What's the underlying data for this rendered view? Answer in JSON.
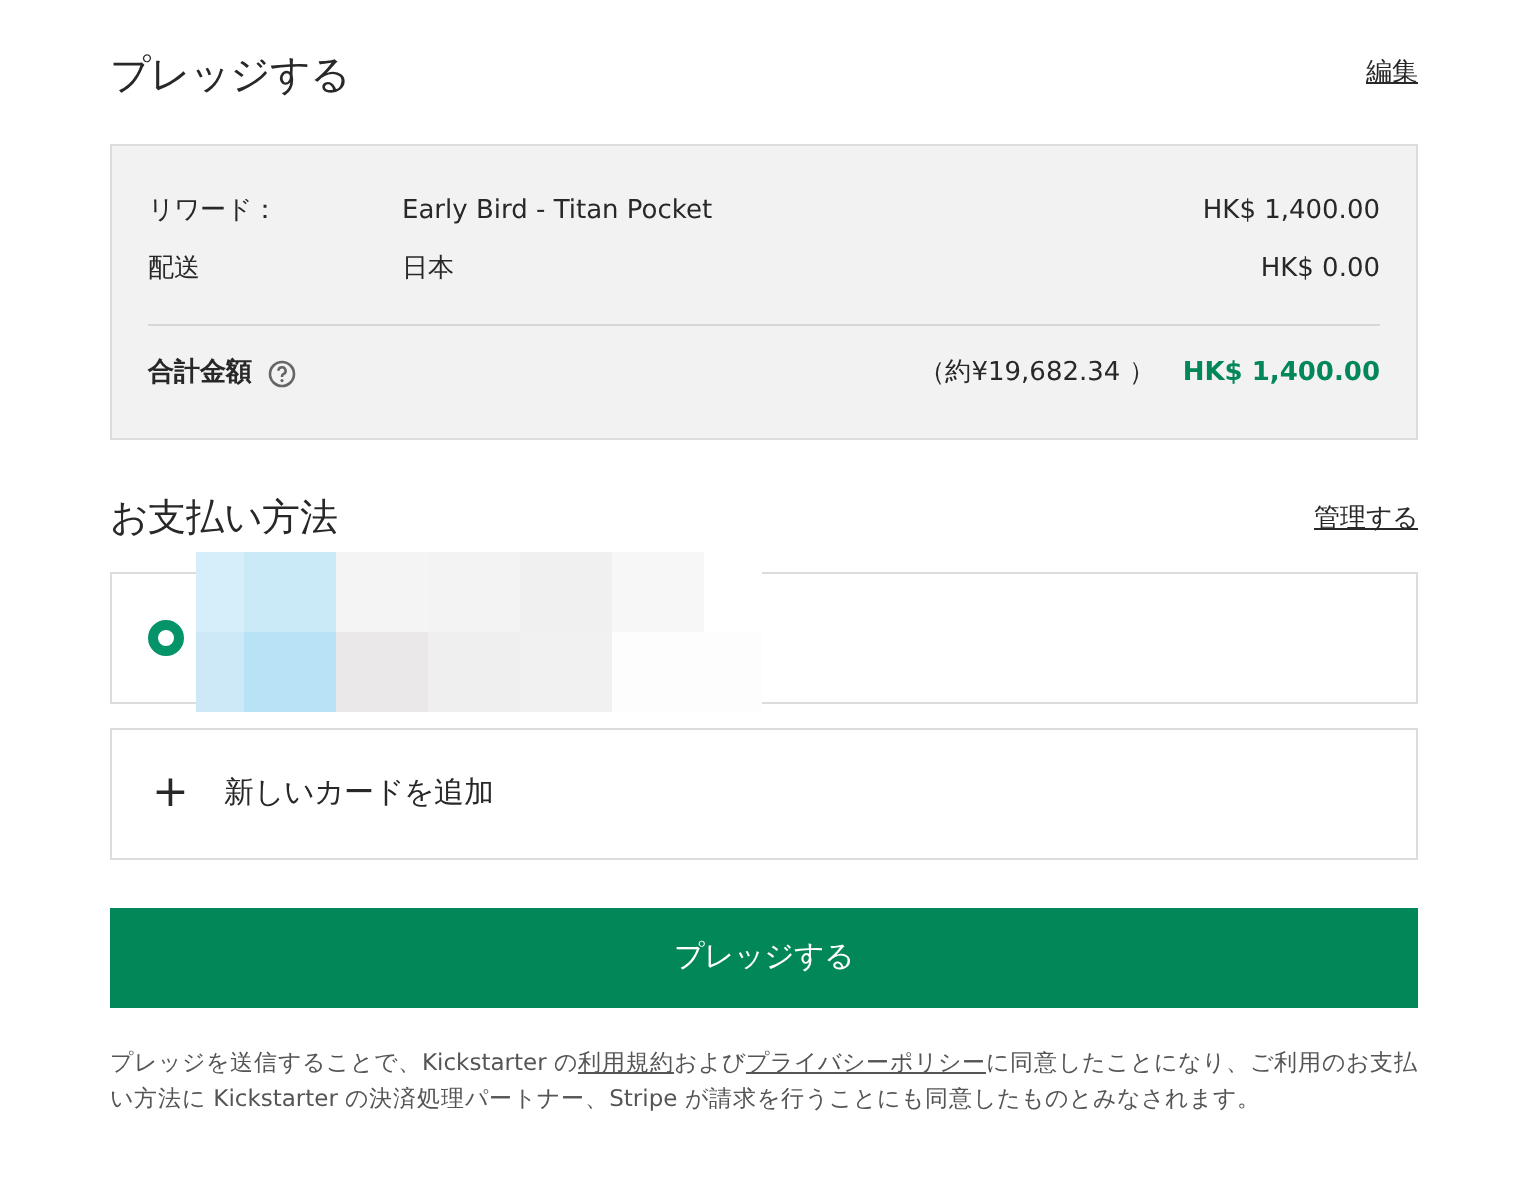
{
  "header": {
    "title": "プレッジする",
    "edit_link": "編集"
  },
  "summary": {
    "rows": [
      {
        "label": "リワード：",
        "detail": "Early Bird - Titan Pocket",
        "amount": "HK$ 1,400.00"
      },
      {
        "label": "配送",
        "detail": "日本",
        "amount": "HK$ 0.00"
      }
    ],
    "total": {
      "label": "合計金額",
      "approx": "（約¥19,682.34 ）",
      "amount": "HK$ 1,400.00"
    }
  },
  "payment": {
    "title": "お支払い方法",
    "manage_link": "管理する",
    "card": {
      "selected": true
    },
    "add_card": {
      "icon": "+",
      "label": "新しいカードを追加"
    }
  },
  "submit_button": "プレッジする",
  "legal": [
    {
      "kind": "text",
      "text": "プレッジを送信することで、Kickstarter の"
    },
    {
      "kind": "link",
      "text": "利用規約"
    },
    {
      "kind": "text",
      "text": "および"
    },
    {
      "kind": "link",
      "text": "プライバシーポリシー"
    },
    {
      "kind": "text",
      "text": "に同意したことになり、ご利用のお支払い方法に Kickstarter の決済処理パートナー、Stripe が請求を行うことにも同意したものとみなされます。"
    }
  ]
}
